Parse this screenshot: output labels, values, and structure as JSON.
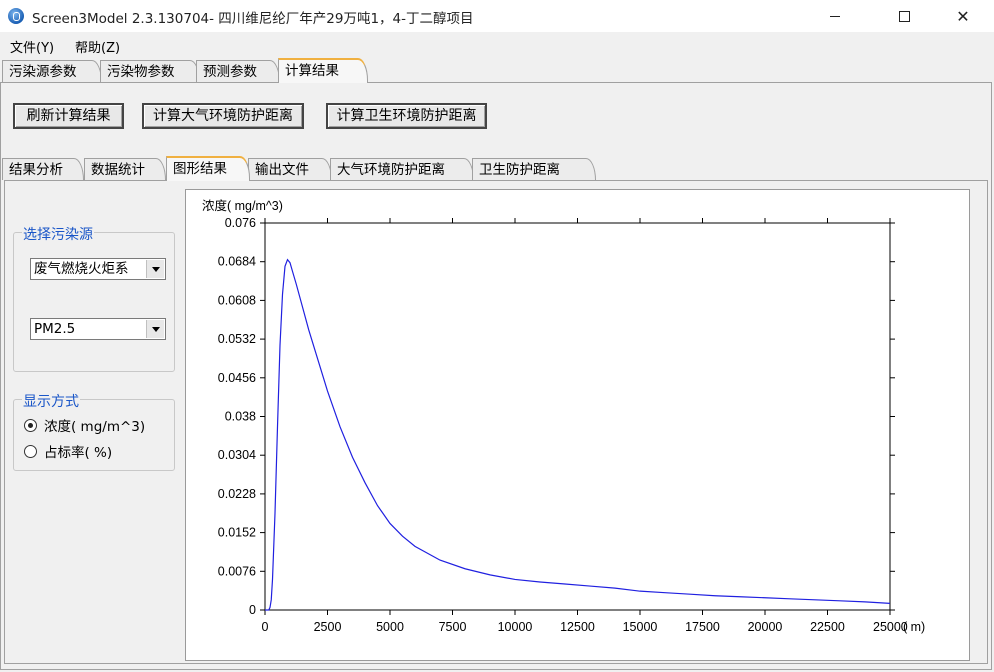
{
  "window": {
    "title": "Screen3Model 2.3.130704- 四川维尼纶厂年产29万吨1，4-丁二醇项目",
    "minimize_icon": "minimize-icon",
    "maximize_icon": "maximize-icon",
    "close_icon": "close-icon"
  },
  "menu": [
    {
      "label": "文件(Y)"
    },
    {
      "label": "帮助(Z)"
    }
  ],
  "main_tabs": [
    {
      "label": "污染源参数"
    },
    {
      "label": "污染物参数"
    },
    {
      "label": "预测参数"
    },
    {
      "label": "计算结果",
      "active": true
    }
  ],
  "actions": {
    "refresh": "刷新计算结果",
    "air_distance": "计算大气环境防护距离",
    "health_distance": "计算卫生环境防护距离"
  },
  "sub_tabs": [
    {
      "label": "结果分析"
    },
    {
      "label": "数据统计"
    },
    {
      "label": "图形结果",
      "active": true
    },
    {
      "label": "输出文件"
    },
    {
      "label": "大气环境防护距离"
    },
    {
      "label": "卫生防护距离"
    }
  ],
  "source_group": {
    "title": "选择污染源",
    "source_value": "废气燃烧火炬系",
    "pollutant_value": "PM2.5"
  },
  "display_group": {
    "title": "显示方式",
    "options": [
      {
        "label": "浓度( mg/m^3)",
        "selected": true
      },
      {
        "label": "占标率( %)",
        "selected": false
      }
    ]
  },
  "chart_data": {
    "type": "line",
    "ylabel": "浓度( mg/m^3)",
    "xlabel": "( m)",
    "ylim": [
      0,
      0.076
    ],
    "xlim": [
      0,
      25000
    ],
    "yticks": [
      "0.076",
      "0.0684",
      "0.0608",
      "0.0532",
      "0.0456",
      "0.038",
      "0.0304",
      "0.0228",
      "0.0152",
      "0.0076",
      "0"
    ],
    "xticks": [
      "0",
      "2500",
      "5000",
      "7500",
      "10000",
      "12500",
      "15000",
      "17500",
      "20000",
      "22500",
      "25000"
    ],
    "color": "#2020e0",
    "series": [
      {
        "x": [
          0,
          150,
          200,
          250,
          300,
          400,
          500,
          600,
          700,
          800,
          900,
          1000,
          1100,
          1250,
          1500,
          1750,
          2000,
          2500,
          3000,
          3500,
          4000,
          4500,
          5000,
          5500,
          6000,
          7000,
          8000,
          9000,
          10000,
          11000,
          12000,
          13000,
          14000,
          15000,
          16000,
          17000,
          18000,
          19000,
          20000,
          21000,
          22000,
          23000,
          24000,
          25000
        ],
        "y": [
          0,
          0,
          0.0005,
          0.002,
          0.006,
          0.019,
          0.036,
          0.052,
          0.062,
          0.0675,
          0.0688,
          0.0682,
          0.0665,
          0.064,
          0.0595,
          0.055,
          0.051,
          0.043,
          0.036,
          0.03,
          0.025,
          0.0205,
          0.017,
          0.0145,
          0.0125,
          0.0098,
          0.0081,
          0.0069,
          0.006,
          0.0055,
          0.0051,
          0.0047,
          0.0043,
          0.0037,
          0.0034,
          0.0031,
          0.0028,
          0.0026,
          0.0024,
          0.0022,
          0.002,
          0.0018,
          0.0016,
          0.0013
        ]
      }
    ]
  }
}
